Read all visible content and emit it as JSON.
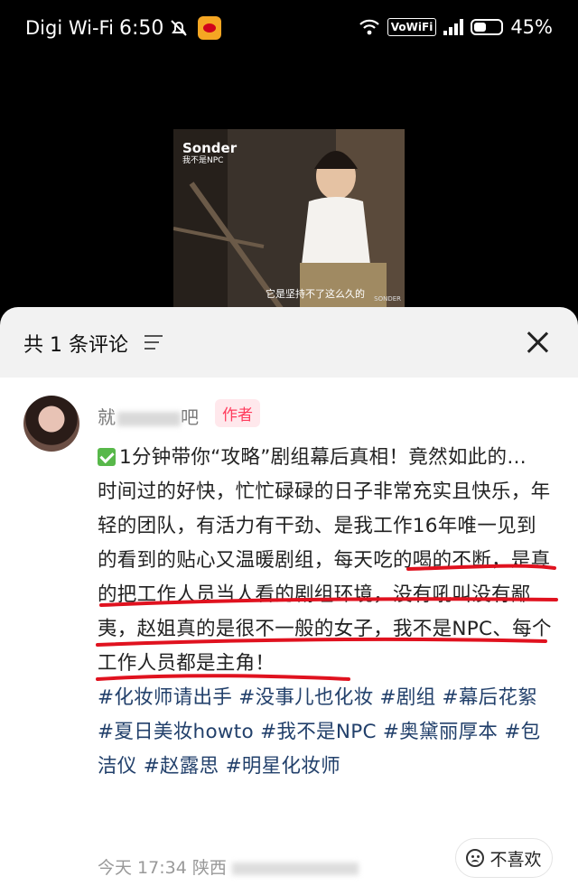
{
  "status_bar": {
    "carrier": "Digi Wi-Fi",
    "time": "6:50",
    "volte": "VoWiFi",
    "battery": "45%",
    "battery_level": 0.45
  },
  "video": {
    "logo": "Sonder",
    "logo_sub": "我不是NPC",
    "subtitle": "它是坚持不了这么久的",
    "watermark": "SONDER"
  },
  "comments_sheet": {
    "title": "共 1 条评论",
    "comment": {
      "username_visible": "就",
      "username_tail": "吧",
      "author_tag": "作者",
      "line_title": "1分钟带你“攻略”剧组幕后真相！竟然如此的…",
      "body": "时间过的好快，忙忙碌碌的日子非常充实且快乐，年轻的团队，有活力有干劲、是我工作16年唯一见到的看到的贴心又温暖剧组，每天吃的喝的不断，是真的把工作人员当人看的剧组环境，没有吼叫没有鄙夷，赵姐真的是很不一般的女子，我不是NPC、每个工作人员都是主角！",
      "hashtags": "#化妆师请出手 #没事儿也化妆 #剧组 #幕后花絮 #夏日美妆howto #我不是NPC #奥黛丽厚本 #包洁仪 #赵露思 #明星化妆师",
      "date": "今天 17:34",
      "location": "陕西",
      "dislike_label": "不喜欢"
    }
  },
  "colors": {
    "hashtag": "#22406b",
    "author_tag": "#ff3b5c",
    "underline": "#e0121f"
  }
}
